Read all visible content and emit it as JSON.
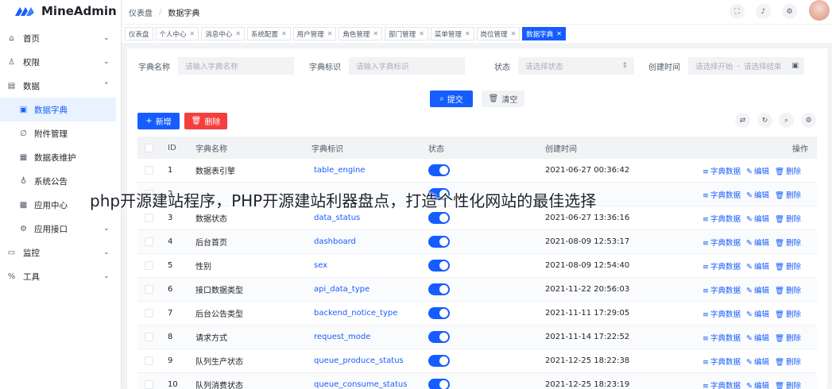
{
  "app": {
    "name": "MineAdmin"
  },
  "colors": {
    "primary": "#165dff",
    "danger": "#f53f3f"
  },
  "sidebar": {
    "items": [
      {
        "label": "首页",
        "icon": "home-icon"
      },
      {
        "label": "权限",
        "icon": "user-key-icon"
      },
      {
        "label": "数据",
        "icon": "data-icon",
        "expanded": true
      },
      {
        "label": "数据字典",
        "icon": "book-icon",
        "active": true
      },
      {
        "label": "附件管理",
        "icon": "paperclip-icon"
      },
      {
        "label": "数据表维护",
        "icon": "storage-icon"
      },
      {
        "label": "系统公告",
        "icon": "bulb-icon"
      },
      {
        "label": "应用中心",
        "icon": "apps-icon"
      },
      {
        "label": "应用接口",
        "icon": "gear-icon"
      },
      {
        "label": "监控",
        "icon": "monitor-icon"
      },
      {
        "label": "工具",
        "icon": "tools-icon"
      }
    ]
  },
  "header": {
    "breadcrumb": [
      "仪表盘",
      "数据字典"
    ]
  },
  "tabs": [
    "仪表盘",
    "个人中心",
    "消息中心",
    "系统配置",
    "用户管理",
    "角色管理",
    "部门管理",
    "菜单管理",
    "岗位管理",
    "数据字典"
  ],
  "search": {
    "name_label": "字典名称",
    "name_placeholder": "请输入字典名称",
    "code_label": "字典标识",
    "code_placeholder": "请输入字典标识",
    "status_label": "状态",
    "status_placeholder": "请选择状态",
    "time_label": "创建时间",
    "time_start": "请选择开始",
    "time_sep": "-",
    "time_end": "请选择结束",
    "submit": "提交",
    "clear": "清空"
  },
  "toolbar": {
    "add": "新增",
    "delete": "删除"
  },
  "table": {
    "headers": {
      "id": "ID",
      "name": "字典名称",
      "code": "字典标识",
      "status": "状态",
      "created": "创建时间",
      "actions": "操作"
    },
    "action_labels": {
      "dict": "字典数据",
      "edit": "编辑",
      "delete": "删除"
    },
    "rows": [
      {
        "id": "1",
        "name": "数据表引擎",
        "code": "table_engine",
        "status": true,
        "created": "2021-06-27 00:36:42"
      },
      {
        "id": "2",
        "name": "",
        "code": "",
        "status": true,
        "created": ""
      },
      {
        "id": "3",
        "name": "数据状态",
        "code": "data_status",
        "status": true,
        "created": "2021-06-27 13:36:16"
      },
      {
        "id": "4",
        "name": "后台首页",
        "code": "dashboard",
        "status": true,
        "created": "2021-08-09 12:53:17"
      },
      {
        "id": "5",
        "name": "性别",
        "code": "sex",
        "status": true,
        "created": "2021-08-09 12:54:40"
      },
      {
        "id": "6",
        "name": "接口数据类型",
        "code": "api_data_type",
        "status": true,
        "created": "2021-11-22 20:56:03"
      },
      {
        "id": "7",
        "name": "后台公告类型",
        "code": "backend_notice_type",
        "status": true,
        "created": "2021-11-11 17:29:05"
      },
      {
        "id": "8",
        "name": "请求方式",
        "code": "request_mode",
        "status": true,
        "created": "2021-11-14 17:22:52"
      },
      {
        "id": "9",
        "name": "队列生产状态",
        "code": "queue_produce_status",
        "status": true,
        "created": "2021-12-25 18:22:38"
      },
      {
        "id": "10",
        "name": "队列消费状态",
        "code": "queue_consume_status",
        "status": true,
        "created": "2021-12-25 18:23:19"
      }
    ]
  },
  "overlay_text": "php开源建站程序，PHP开源建站利器盘点，打造个性化网站的最佳选择"
}
